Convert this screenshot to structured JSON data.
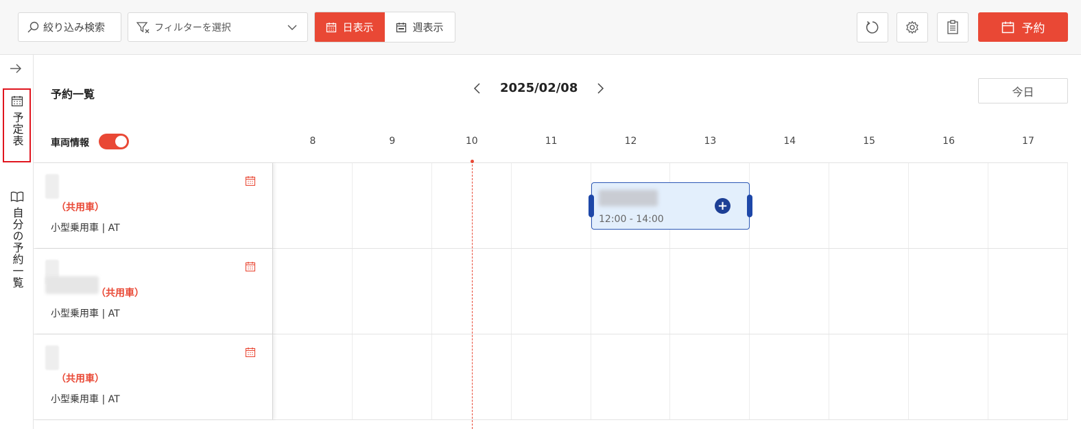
{
  "toolbar": {
    "search_label": "絞り込み検索",
    "filter_placeholder": "フィルターを選択",
    "view_day": "日表示",
    "view_week": "週表示",
    "reserve_label": "予約"
  },
  "rail": {
    "items": [
      {
        "label": "予定表",
        "icon": "calendar-icon",
        "active": true
      },
      {
        "label": "自分の予約一覧",
        "icon": "book-icon",
        "active": false
      }
    ]
  },
  "main": {
    "title": "予約一覧",
    "date": "2025/02/08",
    "today_label": "今日",
    "vehicle_info_label": "車両情報",
    "vehicle_info_toggle": true,
    "hours": [
      "8",
      "9",
      "10",
      "11",
      "12",
      "13",
      "14",
      "15",
      "16",
      "17"
    ]
  },
  "vehicles": [
    {
      "name": "（共用車）",
      "type": "小型乗用車 | AT"
    },
    {
      "name": "（共用車）",
      "type": "小型乗用車 | AT"
    },
    {
      "name": "（共用車）",
      "type": "小型乗用車 | AT"
    }
  ],
  "events": [
    {
      "time": "12:00 - 14:00",
      "vehicle_index": 0
    }
  ],
  "colors": {
    "accent": "#e94835",
    "event_bg": "#e3effc",
    "event_border": "#2a56b4"
  }
}
